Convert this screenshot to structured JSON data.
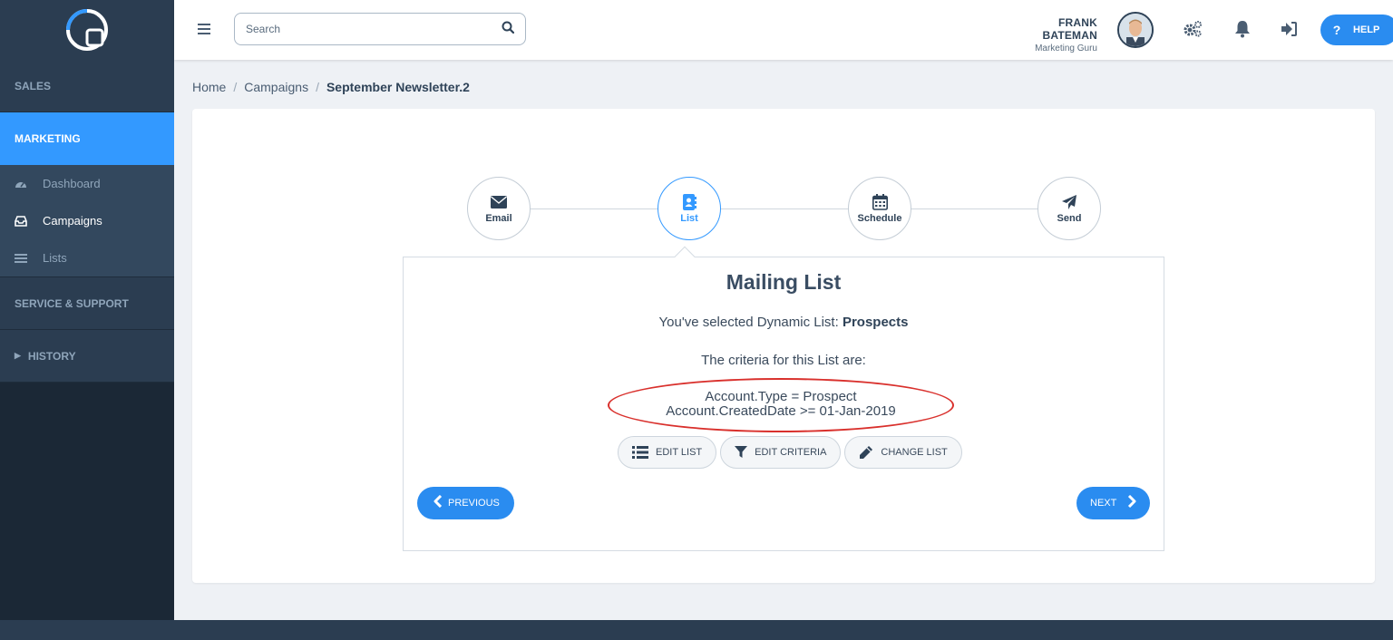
{
  "sidebar": {
    "sections": [
      {
        "label": "SALES"
      },
      {
        "label": "MARKETING"
      },
      {
        "label": "SERVICE & SUPPORT"
      },
      {
        "label": "HISTORY"
      }
    ],
    "marketing_items": [
      {
        "label": "Dashboard",
        "icon": "dashboard-icon"
      },
      {
        "label": "Campaigns",
        "icon": "inbox-icon"
      },
      {
        "label": "Lists",
        "icon": "list-icon"
      }
    ]
  },
  "topbar": {
    "search_placeholder": "Search",
    "user_name": "FRANK BATEMAN",
    "user_role": "Marketing Guru",
    "help_label": "HELP"
  },
  "breadcrumb": {
    "items": [
      "Home",
      "Campaigns",
      "September Newsletter.2"
    ]
  },
  "steps": [
    {
      "label": "Email",
      "icon": "envelope-icon"
    },
    {
      "label": "List",
      "icon": "address-book-icon"
    },
    {
      "label": "Schedule",
      "icon": "calendar-icon"
    },
    {
      "label": "Send",
      "icon": "paper-plane-icon"
    }
  ],
  "panel": {
    "title": "Mailing List",
    "selected_prefix": "You've selected Dynamic List: ",
    "selected_list": "Prospects",
    "criteria_heading": "The criteria for this List are:",
    "criteria": [
      "Account.Type = Prospect",
      "Account.CreatedDate >= 01-Jan-2019"
    ],
    "actions": [
      {
        "label": "EDIT LIST"
      },
      {
        "label": "EDIT CRITERIA"
      },
      {
        "label": "CHANGE LIST"
      }
    ],
    "previous_label": "PREVIOUS",
    "next_label": "NEXT"
  },
  "colors": {
    "accent": "#3399ff",
    "sidebar_bg": "#1b2836",
    "highlight_oval": "#d9302c"
  }
}
